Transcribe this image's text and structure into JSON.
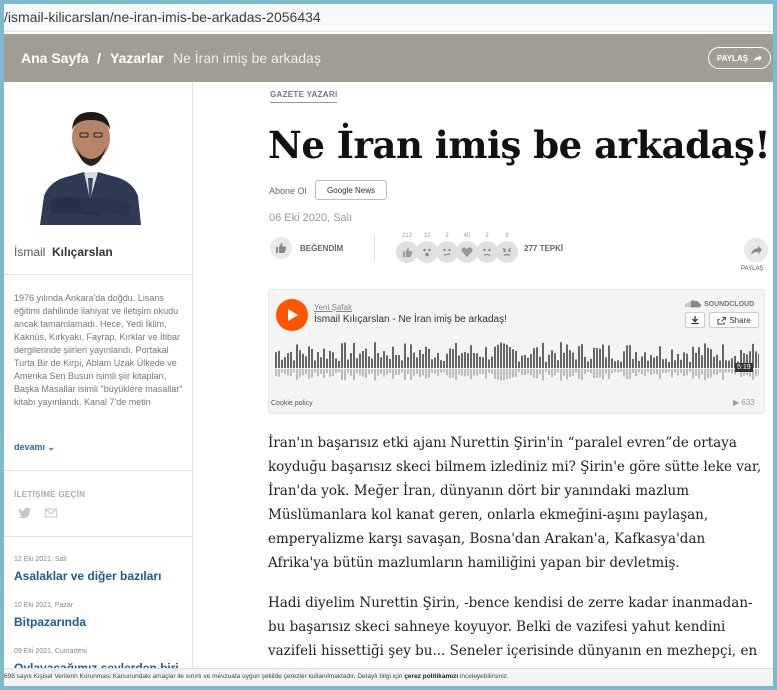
{
  "browser": {
    "url": "/ismail-kilicarslan/ne-iran-imis-be-arkadas-2056434"
  },
  "nav": {
    "home": "Ana Sayfa",
    "sep": "/",
    "section": "Yazarlar",
    "current": "Ne İran imiş be arkadaş",
    "share_label": "PAYLAŞ",
    "bg_color": "#a29d93"
  },
  "author": {
    "first_name": "İsmail",
    "last_name": "Kılıçarslan",
    "bio": "1976 yılında Ankara'da doğdu. Lisans eğitimi dahilinde ilahiyat ve iletişim okudu ancak tamamlamadı. Hece, Yedi İklim, Kaknüs, Kırkyakı, Fayrap, Kırklar ve İtibar dergilerinde şiirleri yayınlandı. Portakal Turta Bir de Kirpi, Ablam Uzak Ülkede ve Amerika Sen Busun isimli şiir kitapları, Başka Masallar isimli \"büyüklere masallar\" kitabı yayınlandı. Kanal 7'de metin",
    "more": "devamı",
    "contact_heading": "İLETİŞİME GEÇİN"
  },
  "other_articles": [
    {
      "date": "12 Eki 2021, Salı",
      "title": "Asalaklar ve diğer bazıları"
    },
    {
      "date": "10 Eki 2021, Pazar",
      "title": "Bitpazarında"
    },
    {
      "date": "09 Eki 2021, Cumartesi",
      "title": "Oylayacağımız şeylerden biri"
    }
  ],
  "article": {
    "tag": "GAZETE YAZARI",
    "title": "Ne İran imiş be arkadaş!",
    "subscribe": "Abone Ol",
    "google_news": "Google News",
    "date": "06 Eki 2020, Salı",
    "like_label": "BEĞENDİM",
    "reaction_counts": [
      "213",
      "12",
      "2",
      "40",
      "2",
      "8"
    ],
    "reaction_total": "277 TEPKİ",
    "share_label": "PAYLAŞ",
    "paragraphs": [
      "İran'ın başarısız etki ajanı Nurettin Şirin'in “paralel evren”de ortaya koyduğu başarısız skeci bilmem izlediniz mi? Şirin'e göre sütte leke var, İran'da yok. Meğer İran, dünyanın dört bir yanındaki mazlum Müslümanlara kol kanat geren, onlarla ekmeğini-aşını paylaşan, emperyalizme karşı savaşan, Bosna'dan Arakan'a, Kafkasya'dan Afrika'ya bütün mazlumların hamiliğini yapan bir devletmiş.",
      "Hadi diyelim Nurettin Şirin, -bence kendisi de zerre kadar inanmadan- bu başarısız skeci sahneye koyuyor. Belki de vazifesi yahut kendini vazifeli hissettiği şey bu... Seneler içerisinde dünyanın en mezhepçi, en eli kanlı"
    ]
  },
  "soundcloud": {
    "user": "Yeni Şafak",
    "track": "İsmail Kılıçarslan - Ne İran imiş be arkadaş!",
    "brand": "SOUNDCLOUD",
    "share": "Share",
    "duration": "5:19",
    "cookie": "Cookie policy",
    "plays": "633",
    "accent": "#ff5500"
  },
  "cookie_bar": {
    "text": "698 sayılı Kişisel Verilerin Korunması Kanunundaki amaçlar ile sınırlı ve mevzuata uygun şekilde çerezler kullanılmaktadır. Detaylı bilgi için ",
    "link": "çerez politikamızı",
    "suffix": " inceleyebilirsiniz."
  }
}
